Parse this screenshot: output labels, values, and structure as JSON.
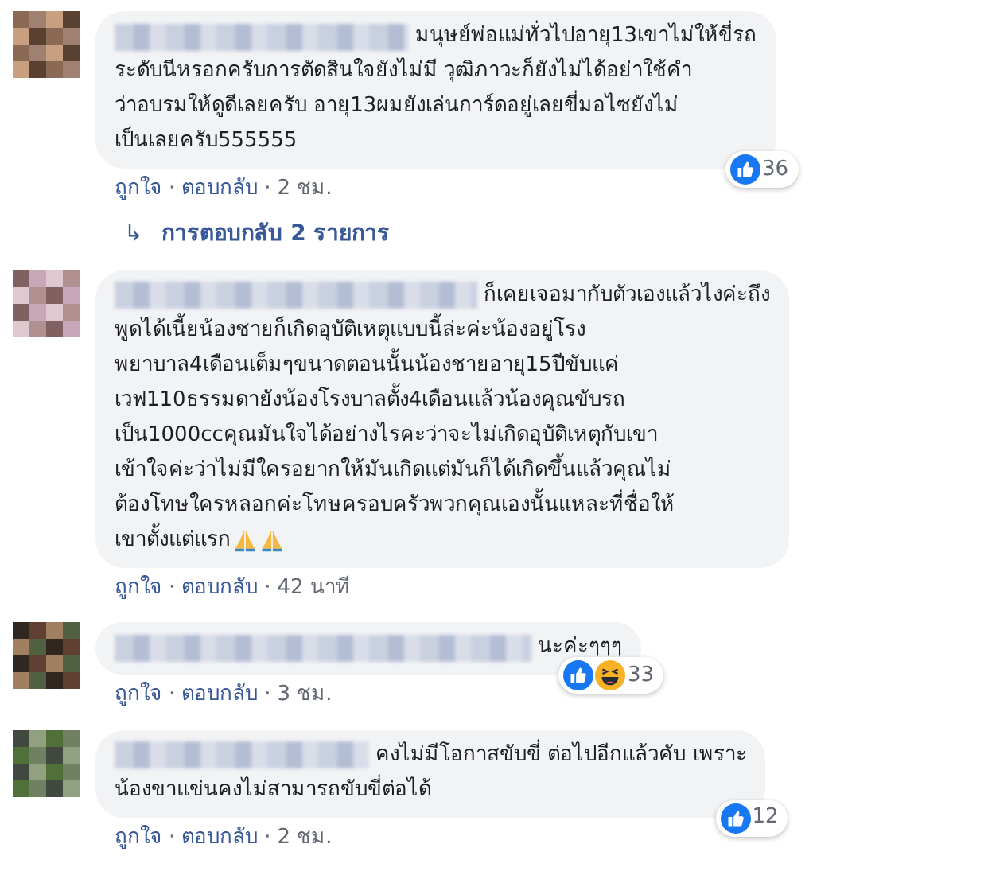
{
  "comments": [
    {
      "lines": [
        "มนุษย์พ่อแม่ทั่วไปอายุ13เขาไม่ให้ขี่รถ",
        "ระดับนีหรอกครับการตัดสินใจยังไม่มี วุฒิภาวะก็ยังไม่ได้อย่าใช้คำ",
        "ว่าอบรมให้ดูดีเลยครับ อายุ13ผมยังเล่นการ์ดอยู่เลยขี่มอไซยังไม่",
        "เป็นเลยครับ555555"
      ],
      "reactions": [
        {
          "kind": "like"
        }
      ],
      "reaction_count": "36",
      "actions": [
        {
          "kind": "link",
          "text": "ถูกใจ"
        },
        {
          "kind": "sep",
          "text": "·"
        },
        {
          "kind": "link",
          "text": "ตอบกลับ"
        },
        {
          "kind": "sep",
          "text": "·"
        },
        {
          "kind": "time",
          "text": "2 ชม."
        }
      ],
      "replies": {
        "arrow": "↳",
        "label": "การตอบกลับ 2 รายการ"
      }
    },
    {
      "lines": [
        "ก็เคยเจอมากับตัวเองแล้วไงค่ะถึง",
        "พูดได้เนี้ยน้องชายก็เกิดอุบัติเหตุแบบนี้ล่ะค่ะน้องอยู่โรง",
        "พยาบาล4เดือนเต็มๆขนาดตอนนั้นน้องชายอายุ15ปีขับแค่",
        "เวฟ110ธรรมดายังน้องโรงบาลตั้ง4เดือนแล้วน้องคุณขับรถ",
        "เป็น1000ccคุณมันใจได้อย่างไรคะว่าจะไม่เกิดอุบัติเหตุกับเขา",
        "เข้าใจค่ะว่าไม่มีใครอยากให้มันเกิดแต่มันก็ได้เกิดขึ้นแล้วคุณไม่",
        "ต้องโทษใครหลอกค่ะโทษครอบครัวพวกคุณเองนั้นแหละที่ชื่อให้",
        "เขาตั้งแต่แรก"
      ],
      "emojis": [
        {
          "kind": "pray"
        },
        {
          "kind": "pray"
        }
      ],
      "actions": [
        {
          "kind": "link",
          "text": "ถูกใจ"
        },
        {
          "kind": "sep",
          "text": "·"
        },
        {
          "kind": "link",
          "text": "ตอบกลับ"
        },
        {
          "kind": "sep",
          "text": "·"
        },
        {
          "kind": "time",
          "text": "42 นาที"
        }
      ]
    },
    {
      "lines": [
        "นะค่ะๆๆๆ"
      ],
      "reactions": [
        {
          "kind": "like"
        },
        {
          "kind": "haha"
        }
      ],
      "reaction_count": "33",
      "actions": [
        {
          "kind": "link",
          "text": "ถูกใจ"
        },
        {
          "kind": "sep",
          "text": "·"
        },
        {
          "kind": "link",
          "text": "ตอบกลับ"
        },
        {
          "kind": "sep",
          "text": "·"
        },
        {
          "kind": "time",
          "text": "3 ชม."
        }
      ]
    },
    {
      "lines": [
        "คงไม่มีโอกาสขับขี่ ต่อไปอีกแล้วคับ เพราะ",
        "น้องขาแข่นคงไม่สามารถขับขี่ต่อได้"
      ],
      "reactions": [
        {
          "kind": "like"
        }
      ],
      "reaction_count": "12",
      "actions": [
        {
          "kind": "link",
          "text": "ถูกใจ"
        },
        {
          "kind": "sep",
          "text": "·"
        },
        {
          "kind": "link",
          "text": "ตอบกลับ"
        },
        {
          "kind": "sep",
          "text": "·"
        },
        {
          "kind": "time",
          "text": "2 ชม."
        }
      ]
    }
  ]
}
